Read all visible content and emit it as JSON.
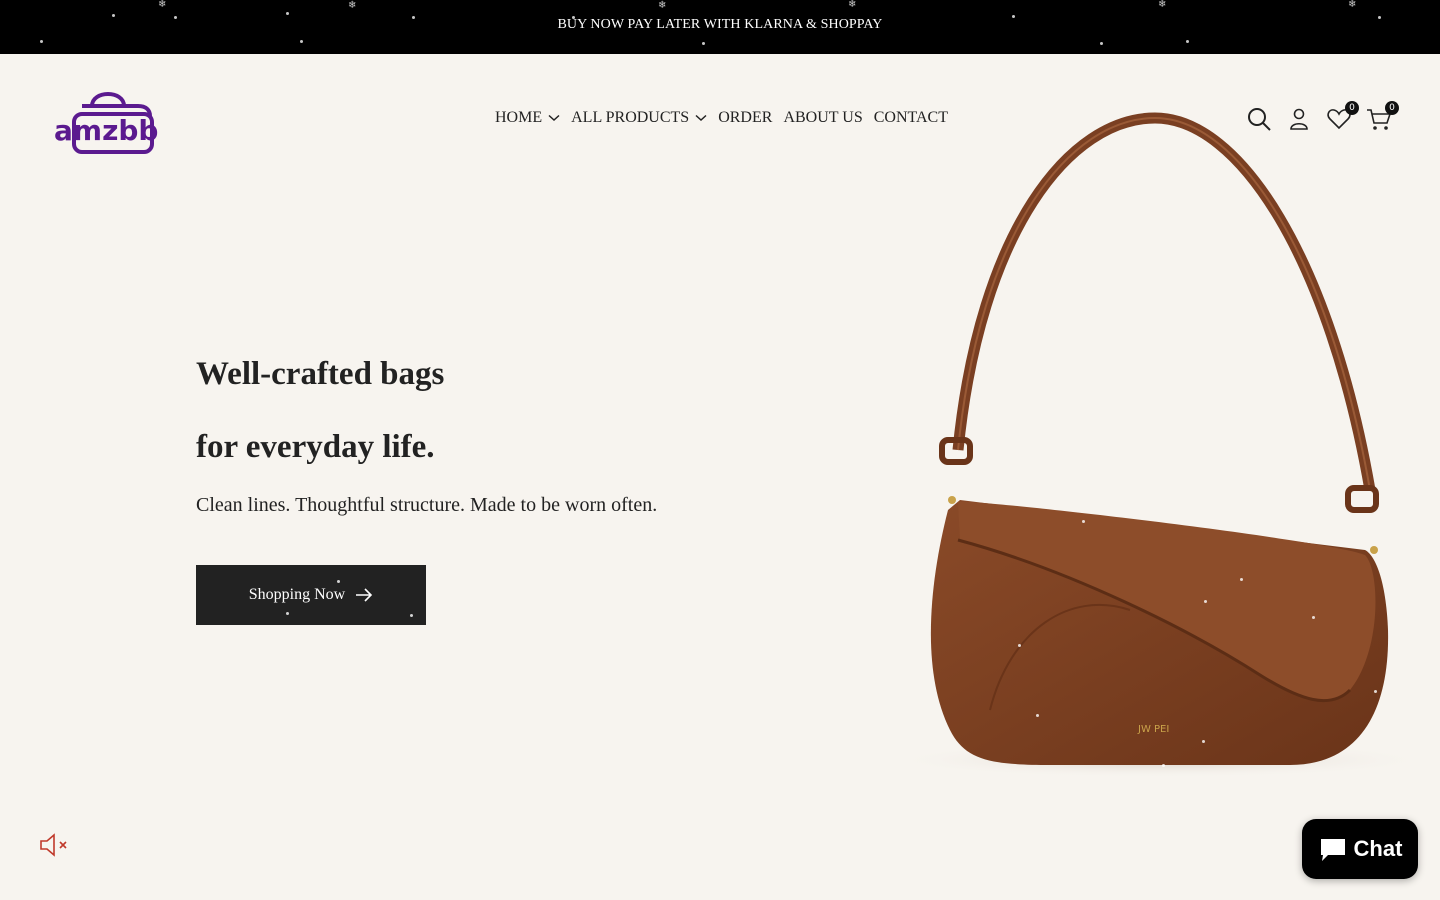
{
  "announcement": {
    "text": "BUY NOW PAY LATER WITH KLARNA & SHOPPAY"
  },
  "brand": {
    "logo_text": "amzbb",
    "logo_color": "#5b1a8f"
  },
  "nav": {
    "items": [
      {
        "label": "HOME",
        "has_dropdown": true
      },
      {
        "label": "ALL PRODUCTS",
        "has_dropdown": true
      },
      {
        "label": "ORDER",
        "has_dropdown": false
      },
      {
        "label": "ABOUT US",
        "has_dropdown": false
      },
      {
        "label": "CONTACT",
        "has_dropdown": false
      }
    ]
  },
  "header_icons": {
    "search": "search-icon",
    "account": "account-icon",
    "wishlist": {
      "icon": "heart-icon",
      "count": "0"
    },
    "cart": {
      "icon": "cart-icon",
      "count": "0"
    }
  },
  "hero": {
    "title_line1": "Well-crafted bags",
    "title_line2": "for everyday life.",
    "subtitle": "Clean lines. Thoughtful structure. Made to be worn often.",
    "cta_label": "Shopping Now",
    "product_brand_mark": "JW PEI",
    "bag_color": "#7a3f22"
  },
  "chat": {
    "label": "Chat"
  },
  "audio": {
    "icon": "mute-icon"
  }
}
